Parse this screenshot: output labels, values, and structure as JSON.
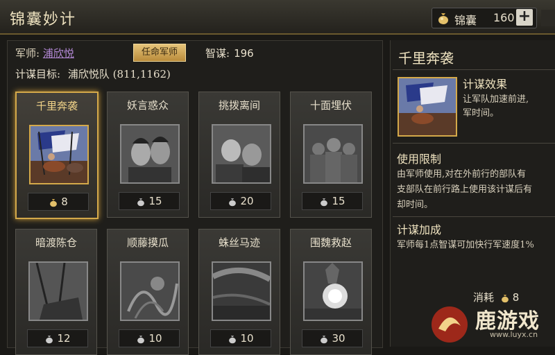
{
  "window": {
    "title": "锦囊妙计"
  },
  "currency": {
    "name": "锦囊",
    "value": "160",
    "bag_icon": "money-bag-icon"
  },
  "info": {
    "advisor_label": "军师:",
    "advisor_name": "浦欣悦",
    "appoint_button": "任命军师",
    "wisdom_label": "智谋:",
    "wisdom_value": "196",
    "target_label": "计谋目标:",
    "target_value": "浦欣悦队 (811,1162)"
  },
  "strategies": [
    {
      "name": "千里奔袭",
      "cost": "8",
      "selected": true
    },
    {
      "name": "妖言惑众",
      "cost": "15"
    },
    {
      "name": "挑拨离间",
      "cost": "20"
    },
    {
      "name": "十面埋伏",
      "cost": "15"
    },
    {
      "name": "暗渡陈仓",
      "cost": "12"
    },
    {
      "name": "顺藤摸瓜",
      "cost": "10"
    },
    {
      "name": "蛛丝马迹",
      "cost": "10"
    },
    {
      "name": "围魏救赵",
      "cost": "30"
    }
  ],
  "detail": {
    "title": "千里奔袭",
    "effect_heading": "计谋效果",
    "effect_text": [
      "让军队加速前进,",
      "军时间。"
    ],
    "limit_heading": "使用限制",
    "limit_text": [
      "由军师使用,对在外前行的部队有",
      "支部队在前行路上使用该计谋后有",
      "却时间。"
    ],
    "bonus_heading": "计谋加成",
    "bonus_text": "军师每1点智谋可加快行军速度1%",
    "consume_label": "消耗",
    "consume_value": "8"
  },
  "watermark": {
    "text": "鹿游戏",
    "url": "www.luyx.cn"
  },
  "colors": {
    "accent": "#d4a94a",
    "advisor": "#b58ad8",
    "background": "#1a1916"
  }
}
